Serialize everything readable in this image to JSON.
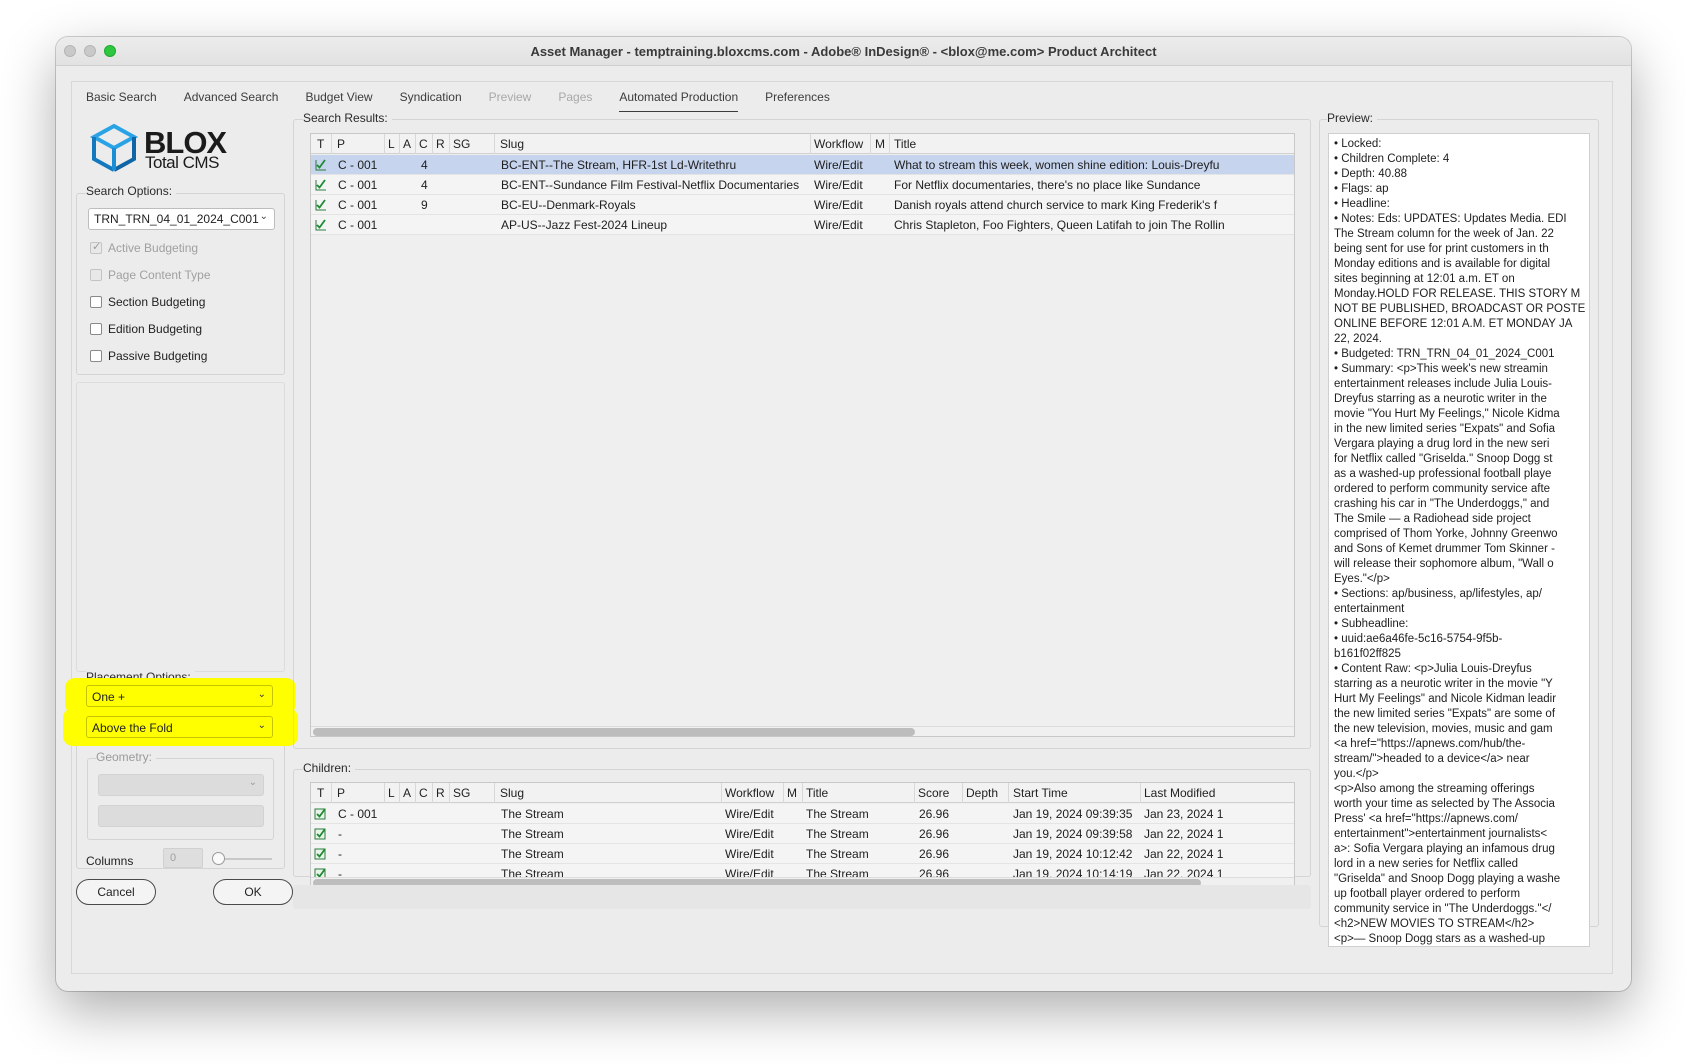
{
  "window": {
    "title": "Asset Manager - temptraining.bloxcms.com - Adobe® InDesign® - <blox@me.com> Product Architect"
  },
  "tabs": [
    {
      "label": "Basic Search",
      "state": "normal"
    },
    {
      "label": "Advanced Search",
      "state": "normal"
    },
    {
      "label": "Budget View",
      "state": "normal"
    },
    {
      "label": "Syndication",
      "state": "normal"
    },
    {
      "label": "Preview",
      "state": "disabled"
    },
    {
      "label": "Pages",
      "state": "disabled"
    },
    {
      "label": "Automated Production",
      "state": "active"
    },
    {
      "label": "Preferences",
      "state": "normal"
    }
  ],
  "logo": {
    "main": "BLOX",
    "sub": "Total CMS"
  },
  "search_options": {
    "label": "Search Options:",
    "budget_select": "TRN_TRN_04_01_2024_C001",
    "checkboxes": [
      {
        "label": "Active Budgeting",
        "checked": true,
        "disabled": true
      },
      {
        "label": "Page Content Type",
        "checked": false,
        "disabled": true
      },
      {
        "label": "Section Budgeting",
        "checked": false,
        "disabled": false
      },
      {
        "label": "Edition Budgeting",
        "checked": false,
        "disabled": false
      },
      {
        "label": "Passive Budgeting",
        "checked": false,
        "disabled": false
      }
    ]
  },
  "placement_options": {
    "label": "Placement Options:",
    "select1": "One +",
    "select2": "Above the Fold",
    "geometry_label": "Geometry:",
    "columns_label": "Columns",
    "columns_value": "0",
    "highlight_color": "#ffff00"
  },
  "buttons": {
    "cancel": "Cancel",
    "ok": "OK"
  },
  "search_results": {
    "label": "Search Results:",
    "headers": [
      "T",
      "P",
      "L",
      "A",
      "C",
      "R",
      "SG",
      "Slug",
      "Workflow",
      "M",
      "Title"
    ],
    "rows": [
      {
        "p": "C - 001",
        "c": "4",
        "slug": "BC-ENT--The Stream, HFR-1st Ld-Writethru",
        "workflow": "Wire/Edit",
        "title": "What to stream this week, women shine edition: Louis-Dreyfu",
        "selected": true
      },
      {
        "p": "C - 001",
        "c": "4",
        "slug": "BC-ENT--Sundance Film Festival-Netflix Documentaries",
        "workflow": "Wire/Edit",
        "title": "For Netflix documentaries, there's no place like Sundance",
        "selected": false
      },
      {
        "p": "C - 001",
        "c": "9",
        "slug": "BC-EU--Denmark-Royals",
        "workflow": "Wire/Edit",
        "title": "Danish royals attend church service to mark King Frederik's f",
        "selected": false
      },
      {
        "p": "C - 001",
        "c": "",
        "slug": "AP-US--Jazz Fest-2024 Lineup",
        "workflow": "Wire/Edit",
        "title": "Chris Stapleton, Foo Fighters, Queen Latifah to join The Rollin",
        "selected": false
      }
    ]
  },
  "children": {
    "label": "Children:",
    "headers": [
      "T",
      "P",
      "L",
      "A",
      "C",
      "R",
      "SG",
      "Slug",
      "Workflow",
      "M",
      "Title",
      "Score",
      "Depth",
      "Start Time",
      "Last Modified"
    ],
    "rows": [
      {
        "p": "C - 001",
        "slug": "The Stream",
        "workflow": "Wire/Edit",
        "title": "The Stream",
        "score": "26.96",
        "start": "Jan 19, 2024 09:39:35",
        "modified": "Jan 23, 2024 1"
      },
      {
        "p": "-",
        "slug": "The Stream",
        "workflow": "Wire/Edit",
        "title": "The Stream",
        "score": "26.96",
        "start": "Jan 19, 2024 09:39:58",
        "modified": "Jan 22, 2024 1"
      },
      {
        "p": "-",
        "slug": "The Stream",
        "workflow": "Wire/Edit",
        "title": "The Stream",
        "score": "26.96",
        "start": "Jan 19, 2024 10:12:42",
        "modified": "Jan 22, 2024 1"
      },
      {
        "p": "-",
        "slug": "The Stream",
        "workflow": "Wire/Edit",
        "title": "The Stream",
        "score": "26.96",
        "start": "Jan 19, 2024 10:14:19",
        "modified": "Jan 22, 2024 1"
      }
    ]
  },
  "preview": {
    "label": "Preview:",
    "lines": [
      "• Locked:",
      "• Children Complete: 4",
      "• Depth: 40.88",
      "• Flags: ap",
      "• Headline:",
      "• Notes: Eds: UPDATES: Updates Media. EDI",
      "The Stream column for the week of Jan. 22",
      "being sent for use for print customers in th",
      "Monday editions and is available for digital",
      "sites beginning at 12:01 a.m. ET on",
      "Monday.HOLD FOR RELEASE. THIS STORY M",
      "NOT BE PUBLISHED, BROADCAST OR POSTE",
      "ONLINE BEFORE 12:01 A.M. ET MONDAY JA",
      "22, 2024.",
      "• Budgeted: TRN_TRN_04_01_2024_C001",
      "• Summary: <p>This week's new streamin",
      "entertainment releases include Julia Louis-",
      "Dreyfus starring as a neurotic writer in the",
      "movie \"You Hurt My Feelings,\" Nicole Kidma",
      "in the new limited series \"Expats\" and Sofia",
      "Vergara playing a drug lord in the new seri",
      "for Netflix called \"Griselda.\" Snoop Dogg st",
      "as a washed-up professional football playe",
      "ordered to perform community service afte",
      "crashing his car in \"The Underdoggs,\" and",
      "The Smile — a Radiohead side project",
      "comprised of Thom Yorke, Johnny Greenwo",
      "and Sons of Kemet drummer Tom Skinner -",
      "will release their sophomore album, \"Wall o",
      "Eyes.\"</p>",
      "• Sections: ap/business, ap/lifestyles, ap/",
      "entertainment",
      "• Subheadline:",
      "• uuid:ae6a46fe-5c16-5754-9f5b-",
      "b161f02ff825",
      "• Content Raw: <p>Julia Louis-Dreyfus",
      "starring as a neurotic writer in the movie \"Y",
      "Hurt My Feelings\" and Nicole Kidman leadir",
      "the new limited series \"Expats\" are some of",
      "the new television, movies, music and gam",
      "<a href=\"https://apnews.com/hub/the-",
      "stream/\">headed to a device</a> near",
      "you.</p>",
      "<p>Also among the streaming offerings",
      "worth your time as selected by The Associa",
      "Press' <a href=\"https://apnews.com/",
      "entertainment\">entertainment journalists<",
      "a>: Sofia Vergara playing an infamous drug",
      "lord in a new series for Netflix called",
      "\"Griselda\" and Snoop Dogg playing a washe",
      "up football player ordered to perform",
      "community service in \"The Underdoggs.\"</",
      "<h2>NEW MOVIES TO STREAM</h2>",
      "<p>— Snoop Dogg stars as a washed-up"
    ]
  }
}
